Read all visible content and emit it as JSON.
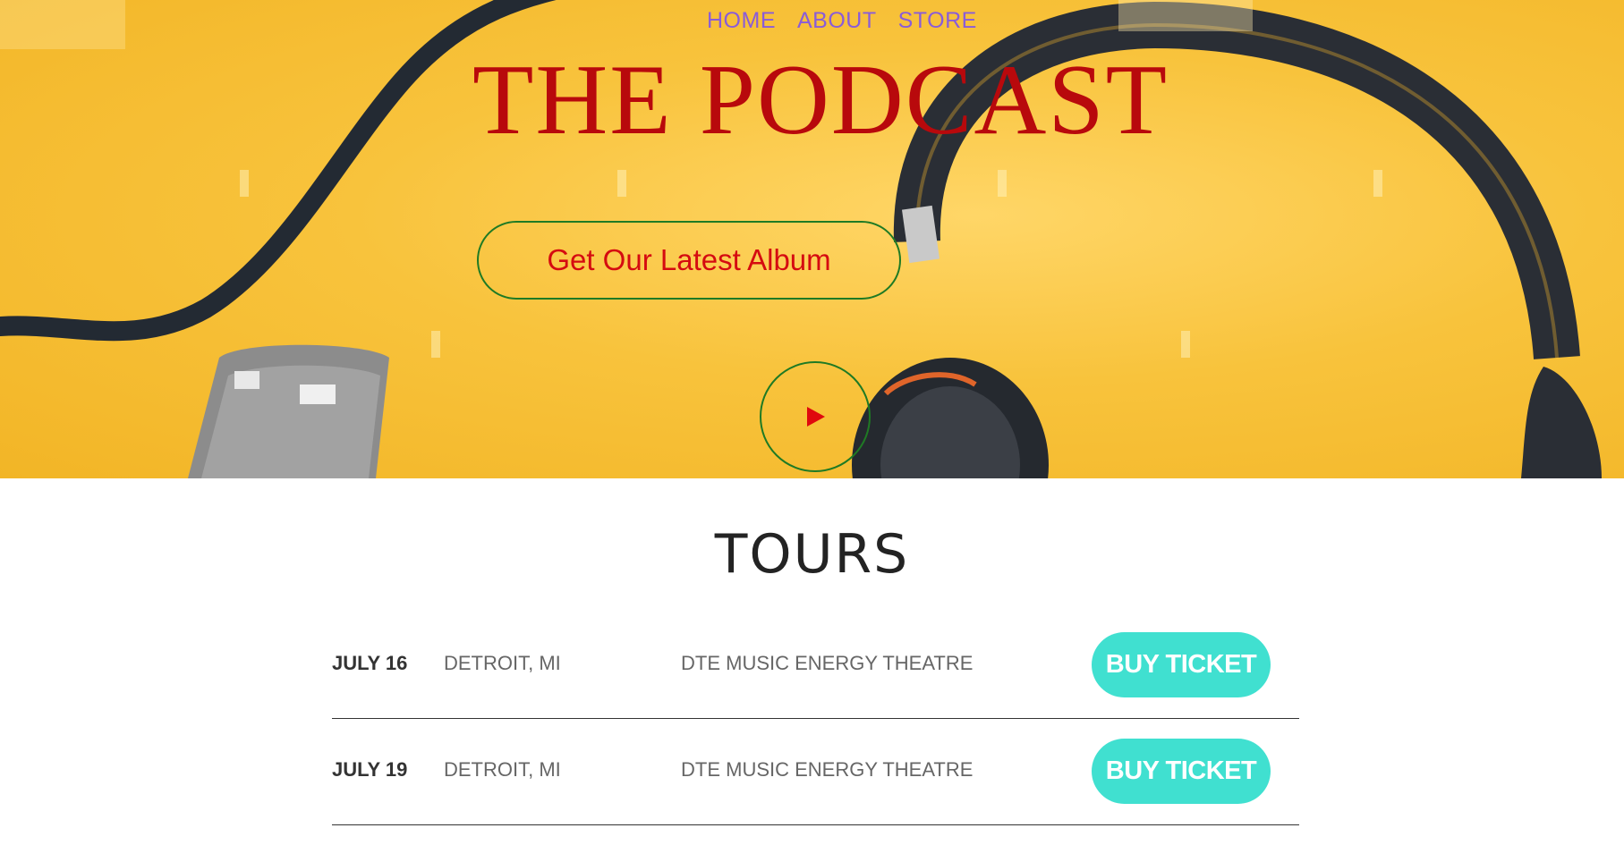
{
  "nav": {
    "home": "HOME",
    "about": "ABOUT",
    "store": "STORE"
  },
  "hero": {
    "title": "THE PODCAST",
    "album_button": "Get Our Latest Album",
    "play_icon": "play-icon",
    "title_color": "#b8090c",
    "background_color": "#f8c33c"
  },
  "tours": {
    "heading": "TOURS",
    "rows": [
      {
        "date": "JULY 16",
        "city": "DETROIT, MI",
        "venue": "DTE MUSIC ENERGY THEATRE",
        "button": "BUY TICKET"
      },
      {
        "date": "JULY 19",
        "city": "DETROIT, MI",
        "venue": "DTE MUSIC ENERGY THEATRE",
        "button": "BUY TICKET"
      }
    ],
    "button_color": "#40e0d0"
  }
}
